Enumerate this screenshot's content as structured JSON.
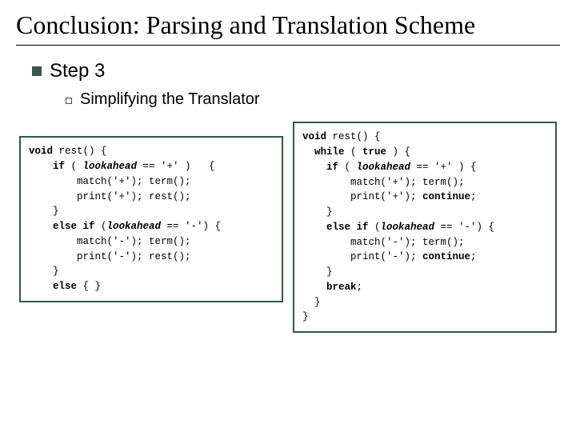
{
  "title": "Conclusion: Parsing and Translation Scheme",
  "bullet": {
    "label": "Step 3"
  },
  "sub": {
    "label": "Simplifying the Translator"
  },
  "code_left": {
    "l0a": "void",
    "l0b": " rest() {",
    "l1a": "    if",
    "l1b": " ( ",
    "l1c": "lookahead",
    "l1d": " == '+' )   {",
    "l2": "        match('+'); term();",
    "l3": "        print('+'); rest();",
    "l4": "    }",
    "l5a": "    else if ",
    "l5b": "(",
    "l5c": "lookahead",
    "l5d": " == '-') {",
    "l6": "        match('-'); term();",
    "l7": "        print('-'); rest();",
    "l8": "    }",
    "l9a": "    else ",
    "l9b": "{ }"
  },
  "code_right": {
    "l0a": "void",
    "l0b": " rest() {",
    "l1a": "  while",
    "l1b": " ( ",
    "l1c": "true",
    "l1d": " ) {",
    "l2a": "    if",
    "l2b": " ( ",
    "l2c": "lookahead",
    "l2d": " == '+' ) {",
    "l3": "        match('+'); term();",
    "l4a": "        print('+'); ",
    "l4b": "continue",
    "l4c": ";",
    "l5": "    }",
    "l6a": "    else if ",
    "l6b": "(",
    "l6c": "lookahead",
    "l6d": " == '-') {",
    "l7": "        match('-'); term();",
    "l8a": "        print('-'); ",
    "l8b": "continue",
    "l8c": ";",
    "l9": "    }",
    "l10a": "    break",
    "l10b": ";",
    "l11": "  }",
    "l12": "}"
  }
}
